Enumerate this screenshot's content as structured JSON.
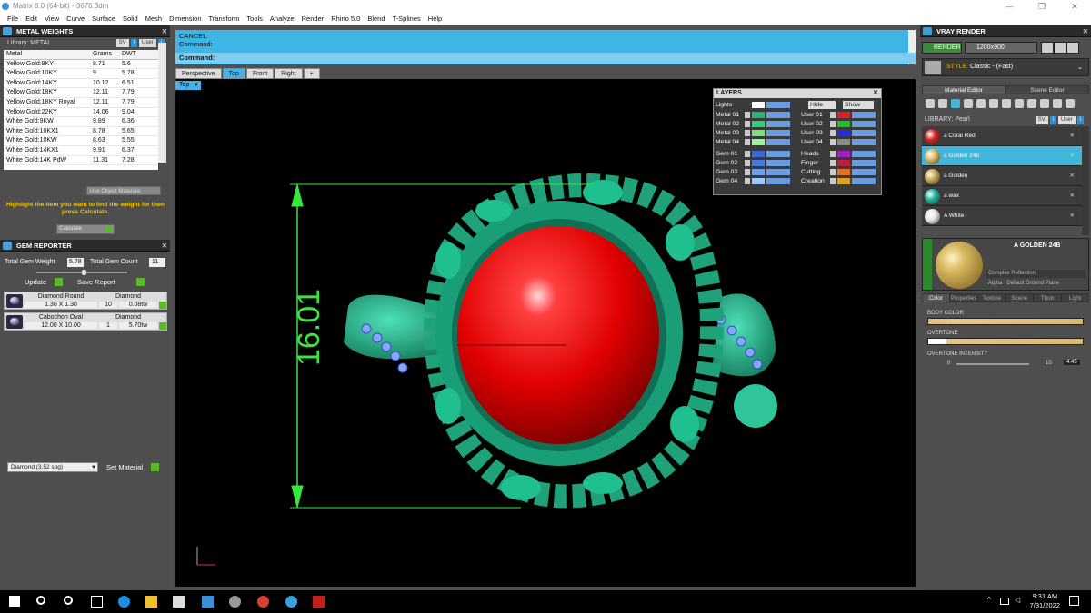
{
  "window": {
    "title": "Matrix 8.0 (64-bit) - 3676.3dm",
    "min": "—",
    "max": "❐",
    "close": "✕"
  },
  "menu": [
    "File",
    "Edit",
    "View",
    "Curve",
    "Surface",
    "Solid",
    "Mesh",
    "Dimension",
    "Transform",
    "Tools",
    "Analyze",
    "Render",
    "Rhino 5.0",
    "Blend",
    "T-Splines",
    "Help"
  ],
  "metal_weights": {
    "title": "METAL WEIGHTS",
    "library": "Library: METAL",
    "btn_sv": "SV",
    "btn_user": "User",
    "headers": [
      "Metal",
      "Grams",
      "DWT"
    ],
    "rows": [
      [
        "Yellow Gold:9KY",
        "8.71",
        "5.6"
      ],
      [
        "Yellow Gold:10KY",
        "9",
        "5.78"
      ],
      [
        "Yellow Gold:14KY",
        "10.12",
        "6.51"
      ],
      [
        "Yellow Gold:18KY",
        "12.11",
        "7.79"
      ],
      [
        "Yellow Gold:18KY Royal",
        "12.11",
        "7.79"
      ],
      [
        "Yellow Gold:22KY",
        "14.06",
        "9.04"
      ],
      [
        "White Gold:9KW",
        "9.89",
        "6.36"
      ],
      [
        "White Gold:10KX1",
        "8.78",
        "5.65"
      ],
      [
        "White Gold:10KW",
        "8.63",
        "5.55"
      ],
      [
        "White Gold:14KX1",
        "9.91",
        "6.37"
      ],
      [
        "White Gold:14K PdW",
        "11.31",
        "7.28"
      ]
    ],
    "use_object": "Use Object Materials",
    "hint": "Highlight the item you want to find the weight for then press Calculate.",
    "calculate": "Calculate"
  },
  "gem_reporter": {
    "title": "GEM REPORTER",
    "total_weight_label": "Total Gem Weight",
    "total_weight": "5.78",
    "total_count_label": "Total Gem Count",
    "total_count": "11",
    "update": "Update",
    "save_report": "Save Report",
    "gems": [
      {
        "name": "Diamond Round",
        "material": "Diamond",
        "size": "1.30 X 1.30",
        "qty": "10",
        "weight": "0.08tw"
      },
      {
        "name": "Cabochon Oval",
        "material": "Diamond",
        "size": "12.00 X 10.00",
        "qty": "1",
        "weight": "5.70tw"
      }
    ],
    "select": "Diamond    (3.52 spg)",
    "set_material": "Set Material"
  },
  "command": {
    "cancel": "CANCEL",
    "command1": "Command:",
    "prompt": "Command:"
  },
  "viewport_tabs": [
    {
      "label": "Perspective",
      "active": false
    },
    {
      "label": "Top",
      "active": true
    },
    {
      "label": "Front",
      "active": false
    },
    {
      "label": "Right",
      "active": false
    },
    {
      "label": "+",
      "active": false
    }
  ],
  "viewport_label": "Top",
  "dimension": "16.01",
  "layers": {
    "title": "LAYERS",
    "lights": "Lights",
    "hide": "Hide",
    "show": "Show",
    "left": [
      {
        "name": "Metal 01",
        "color": "#2bb07a"
      },
      {
        "name": "Metal 02",
        "color": "#2bd07a"
      },
      {
        "name": "Metal 03",
        "color": "#7ae07a"
      },
      {
        "name": "Metal 04",
        "color": "#a0f0a0"
      },
      {
        "name": "Gem 01",
        "color": "#3a6ad8"
      },
      {
        "name": "Gem 02",
        "color": "#4a7ae0"
      },
      {
        "name": "Gem 03",
        "color": "#6aa0f0"
      },
      {
        "name": "Gem 04",
        "color": "#a0c8ff"
      }
    ],
    "right": [
      {
        "name": "User 01",
        "color": "#e02020"
      },
      {
        "name": "User 02",
        "color": "#20c020"
      },
      {
        "name": "User 03",
        "color": "#2030e0"
      },
      {
        "name": "User 04",
        "color": "#888888"
      },
      {
        "name": "Heads",
        "color": "#a020c0"
      },
      {
        "name": "Finger",
        "color": "#c02040"
      },
      {
        "name": "Cutting",
        "color": "#e07020"
      },
      {
        "name": "Creation",
        "color": "#e0a020"
      }
    ]
  },
  "vray": {
    "title": "VRAY RENDER",
    "render": "RENDER",
    "resolution": "1200x900",
    "style_key": "STYLE",
    "style_value": "Classic - (Fast)",
    "tabs": [
      "Material Editor",
      "Scene Editor"
    ],
    "library": "LIBRARY: Pearl",
    "btn_sv": "SV",
    "btn_user": "User",
    "materials": [
      {
        "name": "a Coral Red",
        "color": "#d02020",
        "selected": false
      },
      {
        "name": "a Golden 24b",
        "color": "#d8b860",
        "selected": true
      },
      {
        "name": "a Golden",
        "color": "#c8a850",
        "selected": false
      },
      {
        "name": "a wax",
        "color": "#20b0a0",
        "selected": false
      },
      {
        "name": "A White",
        "color": "#e8e8e8",
        "selected": false
      }
    ],
    "selected_name": "A GOLDEN 24B",
    "reflection": "Complex Reflection",
    "alpha": "Alpha",
    "ground": "Default Ground Plane",
    "color_tabs": [
      "Color",
      "Properties",
      "Texture",
      "Scene",
      "Tbon",
      "Light"
    ],
    "body_color": "BODY COLOR",
    "overtone": "OVERTONE",
    "overtone_intensity": "OVERTONE INTENSITY",
    "intensity_min": "0",
    "intensity_max": "10",
    "intensity_value": "4.45"
  },
  "taskbar": {
    "time": "9:31 AM",
    "date": "7/31/2022"
  }
}
